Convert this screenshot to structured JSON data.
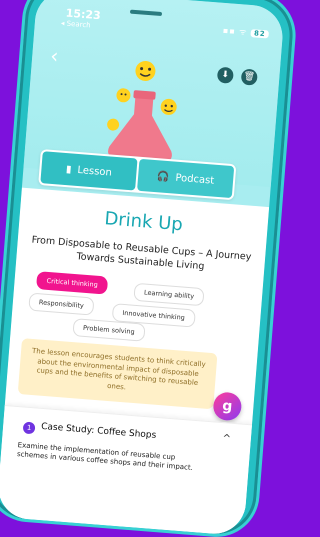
{
  "status_bar": {
    "time": "15:23",
    "back": "◂ Search",
    "icons": "▪▪ ᯤ",
    "battery": "82"
  },
  "header": {
    "back_glyph": "‹",
    "download_glyph": "⬇",
    "delete_glyph": "🗑"
  },
  "tabs": [
    {
      "label": "Lesson",
      "icon": "book-icon"
    },
    {
      "label": "Podcast",
      "icon": "headphones-icon"
    }
  ],
  "lesson": {
    "title": "Drink Up",
    "subtitle": "From Disposable to Reusable Cups – A Journey Towards Sustainable Living",
    "skills": [
      "Critical thinking",
      "Learning ability",
      "Responsibility",
      "Innovative thinking",
      "Problem solving"
    ],
    "summary": "The lesson encourages students to think critically about the environmental impact of disposable cups and the benefits of switching to reusable ones."
  },
  "case_study": {
    "number": "1",
    "title": "Case Study: Coffee Shops",
    "description": "Examine the implementation of reusable cup schemes in various coffee shops and their impact.",
    "chevron": "^"
  },
  "fab": {
    "glyph": "g"
  },
  "colors": {
    "background": "#7d11dc",
    "phone": "#25c0c4",
    "accent": "#19a7b2",
    "chip_selected": "#f1148e",
    "summary_bg": "#fff0c8"
  }
}
